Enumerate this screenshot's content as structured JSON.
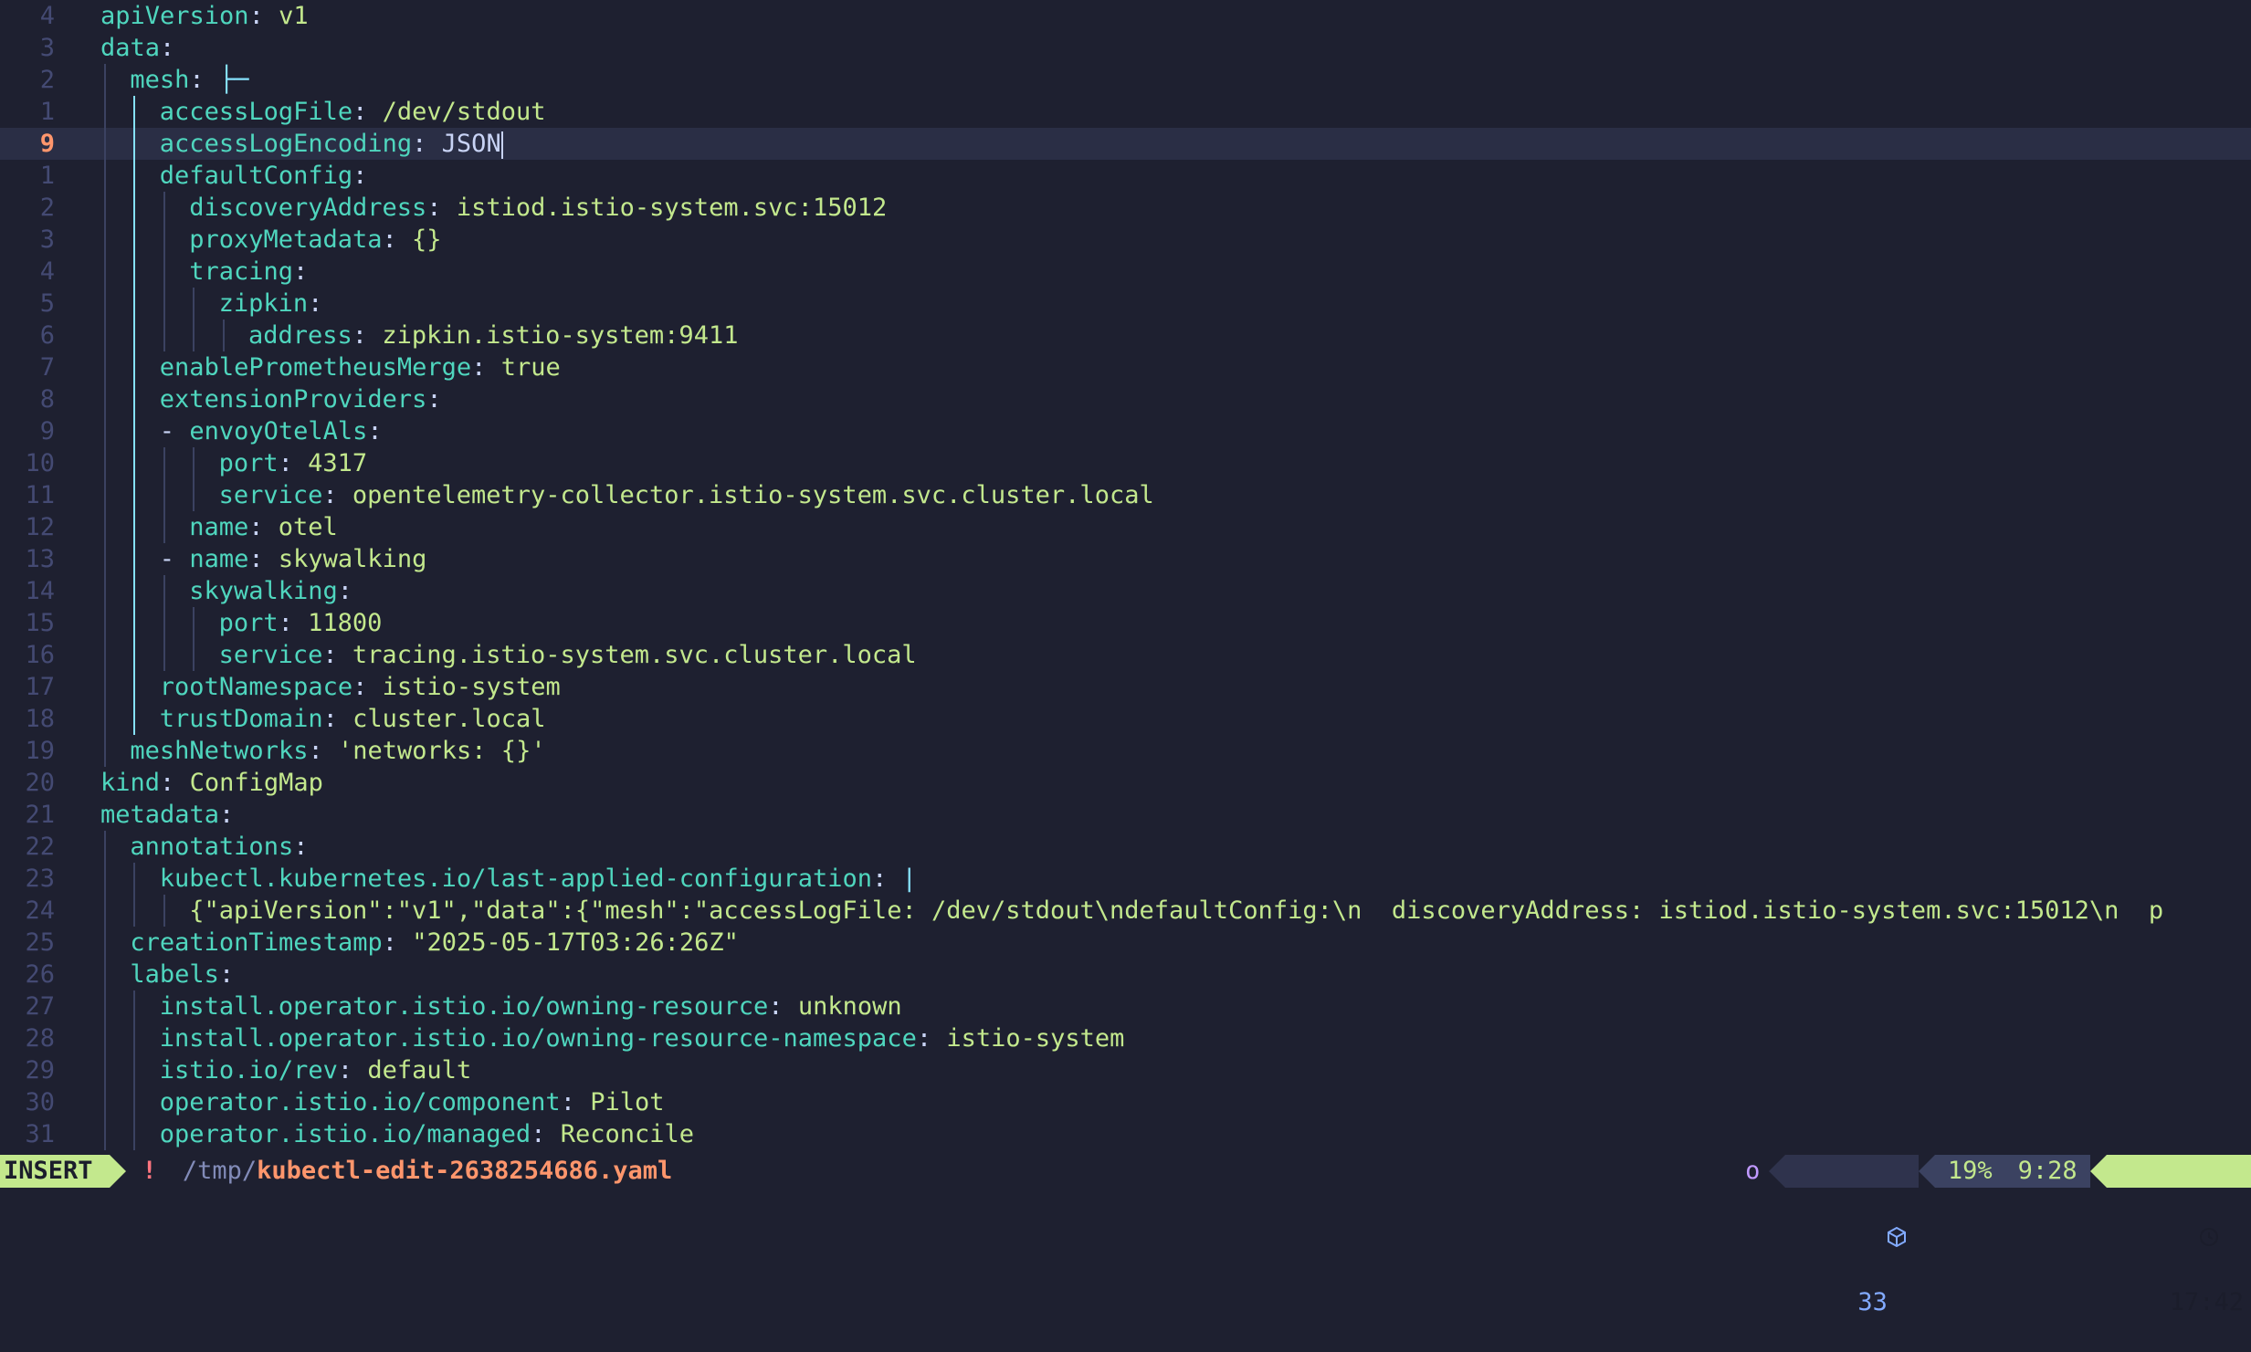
{
  "editor": {
    "lines": [
      {
        "ln": "4",
        "indent": 0,
        "key": "apiVersion",
        "val": "v1"
      },
      {
        "ln": "3",
        "indent": 0,
        "key": "data",
        "val": ""
      },
      {
        "ln": "2",
        "indent": 1,
        "key": "mesh",
        "val": "├─"
      },
      {
        "ln": "1",
        "indent": 2,
        "key": "accessLogFile",
        "val": "/dev/stdout"
      },
      {
        "ln": "9",
        "indent": 2,
        "key": "accessLogEncoding",
        "val": "JSON",
        "current": true
      },
      {
        "ln": "1",
        "indent": 2,
        "key": "defaultConfig",
        "val": ""
      },
      {
        "ln": "2",
        "indent": 3,
        "key": "discoveryAddress",
        "val": "istiod.istio-system.svc:15012"
      },
      {
        "ln": "3",
        "indent": 3,
        "key": "proxyMetadata",
        "val": "{}"
      },
      {
        "ln": "4",
        "indent": 3,
        "key": "tracing",
        "val": ""
      },
      {
        "ln": "5",
        "indent": 4,
        "key": "zipkin",
        "val": ""
      },
      {
        "ln": "6",
        "indent": 5,
        "key": "address",
        "val": "zipkin.istio-system:9411"
      },
      {
        "ln": "7",
        "indent": 2,
        "key": "enablePrometheusMerge",
        "val": "true"
      },
      {
        "ln": "8",
        "indent": 2,
        "key": "extensionProviders",
        "val": ""
      },
      {
        "ln": "9",
        "indent": 2,
        "dash": true,
        "key": "envoyOtelAls",
        "val": ""
      },
      {
        "ln": "10",
        "indent": 4,
        "key": "port",
        "val": "4317"
      },
      {
        "ln": "11",
        "indent": 4,
        "key": "service",
        "val": "opentelemetry-collector.istio-system.svc.cluster.local"
      },
      {
        "ln": "12",
        "indent": 3,
        "key": "name",
        "val": "otel"
      },
      {
        "ln": "13",
        "indent": 2,
        "dash": true,
        "key": "name",
        "val": "skywalking"
      },
      {
        "ln": "14",
        "indent": 3,
        "key": "skywalking",
        "val": ""
      },
      {
        "ln": "15",
        "indent": 4,
        "key": "port",
        "val": "11800"
      },
      {
        "ln": "16",
        "indent": 4,
        "key": "service",
        "val": "tracing.istio-system.svc.cluster.local"
      },
      {
        "ln": "17",
        "indent": 2,
        "key": "rootNamespace",
        "val": "istio-system"
      },
      {
        "ln": "18",
        "indent": 2,
        "key": "trustDomain",
        "val": "cluster.local"
      },
      {
        "ln": "19",
        "indent": 1,
        "key": "meshNetworks",
        "val": "'networks: {}'"
      },
      {
        "ln": "20",
        "indent": 0,
        "key": "kind",
        "val": "ConfigMap"
      },
      {
        "ln": "21",
        "indent": 0,
        "key": "metadata",
        "val": ""
      },
      {
        "ln": "22",
        "indent": 1,
        "key": "annotations",
        "val": ""
      },
      {
        "ln": "23",
        "indent": 2,
        "key": "kubectl.kubernetes.io/last-applied-configuration",
        "val": "|"
      },
      {
        "ln": "24",
        "indent": 3,
        "raw": "{\"apiVersion\":\"v1\",\"data\":{\"mesh\":\"accessLogFile: /dev/stdout\\ndefaultConfig:\\n  discoveryAddress: istiod.istio-system.svc:15012\\n  p"
      },
      {
        "ln": "25",
        "indent": 1,
        "key": "creationTimestamp",
        "val": "\"2025-05-17T03:26:26Z\""
      },
      {
        "ln": "26",
        "indent": 1,
        "key": "labels",
        "val": ""
      },
      {
        "ln": "27",
        "indent": 2,
        "key": "install.operator.istio.io/owning-resource",
        "val": "unknown"
      },
      {
        "ln": "28",
        "indent": 2,
        "key": "install.operator.istio.io/owning-resource-namespace",
        "val": "istio-system"
      },
      {
        "ln": "29",
        "indent": 2,
        "key": "istio.io/rev",
        "val": "default"
      },
      {
        "ln": "30",
        "indent": 2,
        "key": "operator.istio.io/component",
        "val": "Pilot"
      },
      {
        "ln": "31",
        "indent": 2,
        "key": "operator.istio.io/managed",
        "val": "Reconcile"
      }
    ]
  },
  "statusline": {
    "mode": "INSERT",
    "modified": "!",
    "path_dir": "/tmp/",
    "path_file": "kubectl-edit-2638254686.yaml",
    "indicator": "o",
    "lsp_count": "33",
    "percent": "19%",
    "position": "9:28",
    "clock": "17:42"
  }
}
